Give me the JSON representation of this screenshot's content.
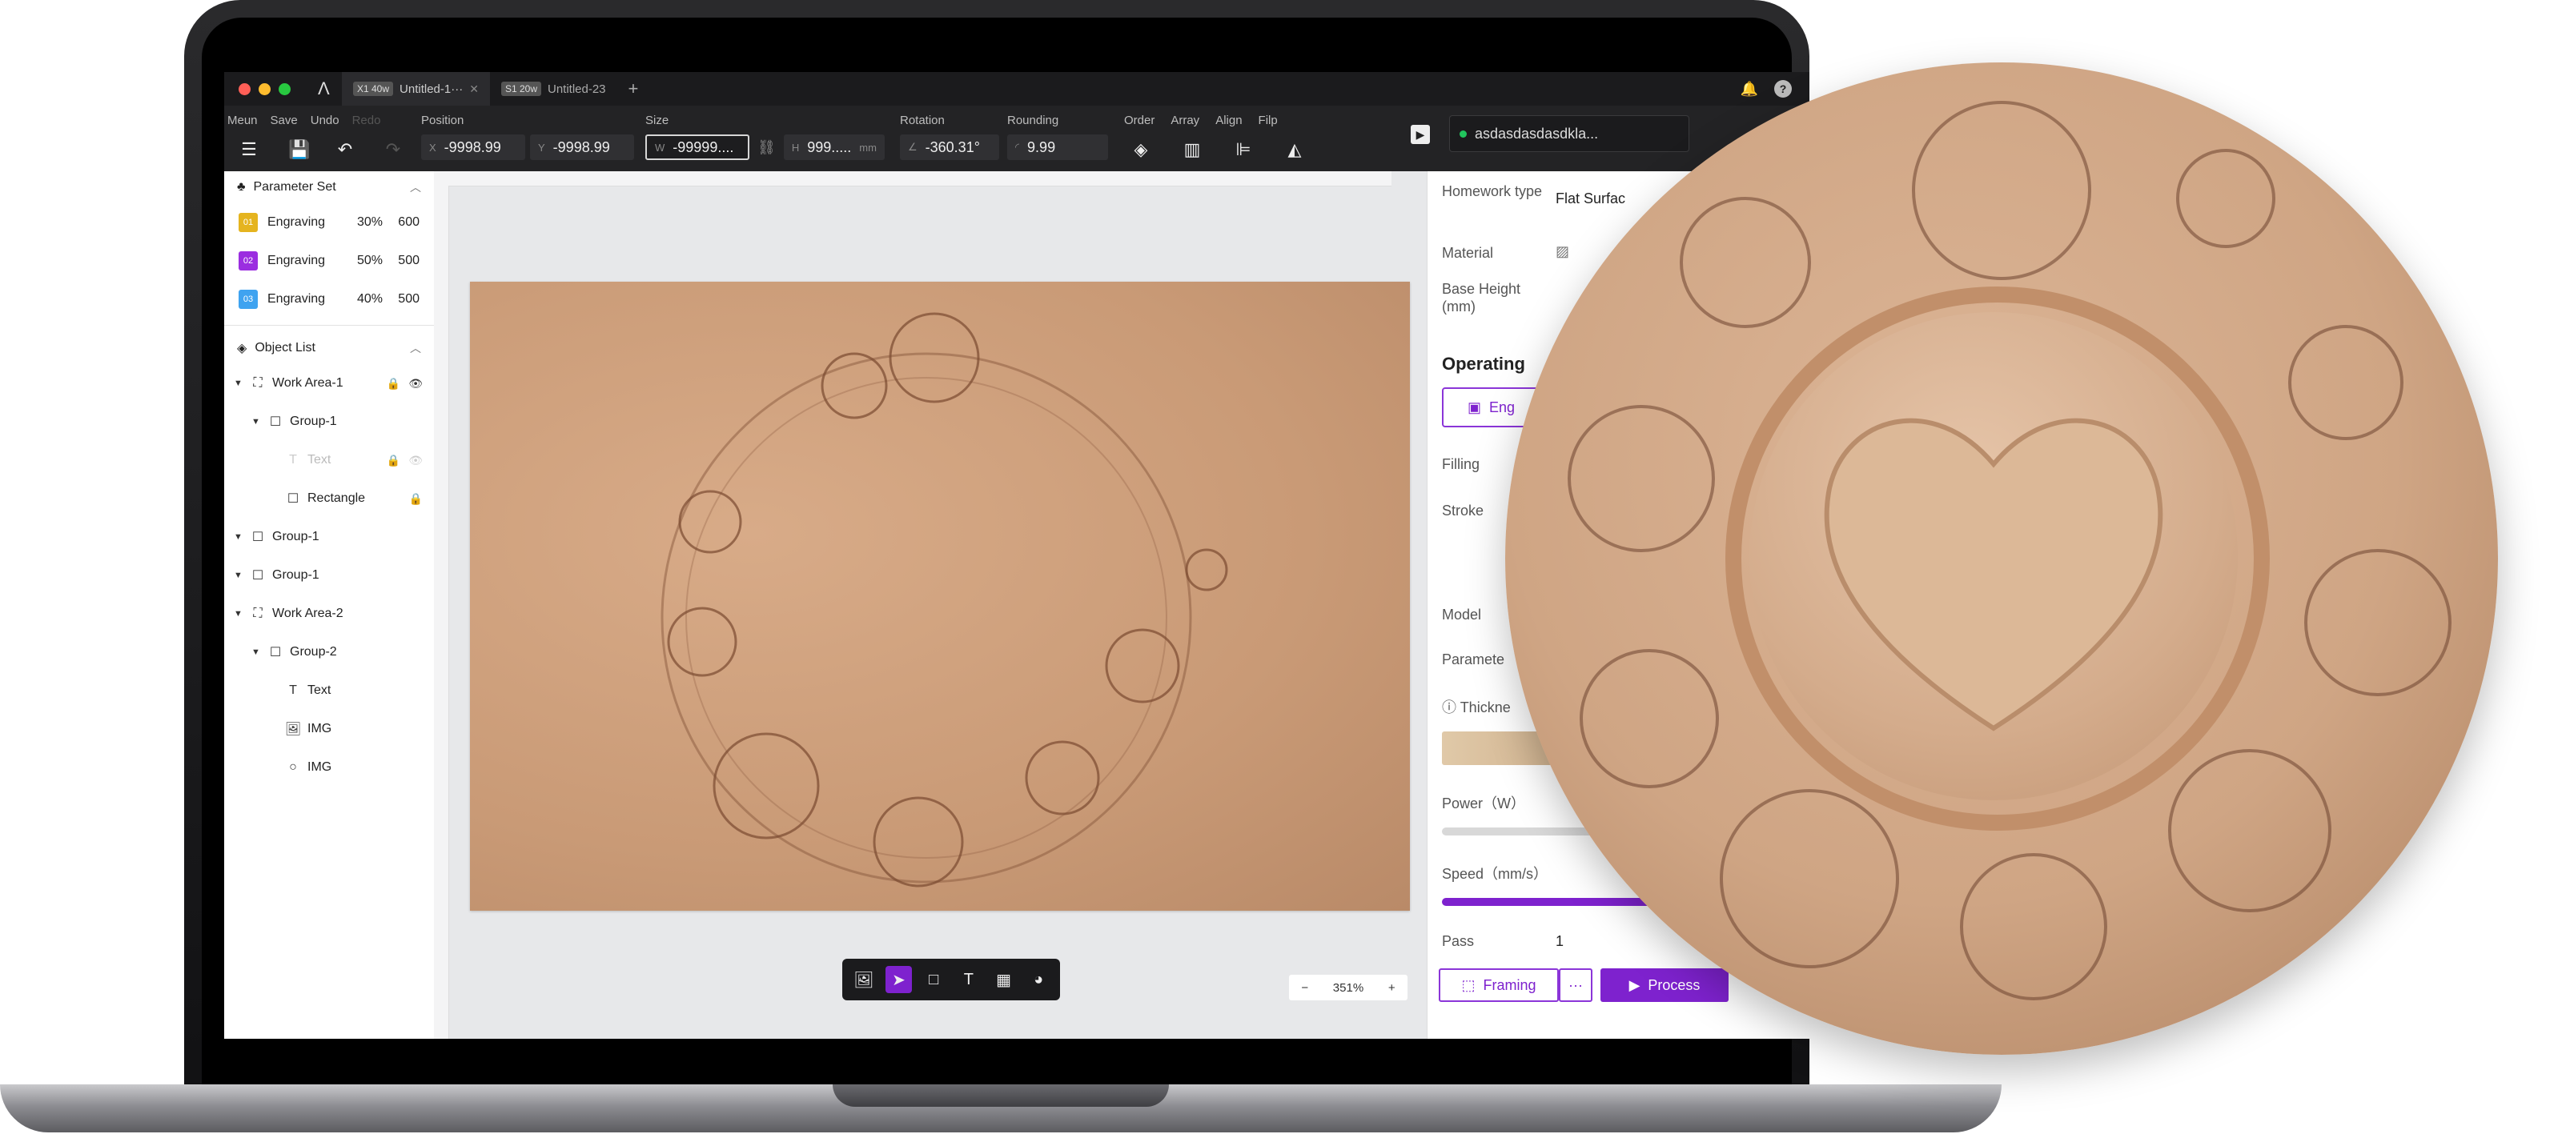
{
  "window": {
    "tabs": [
      {
        "badge": "X1 40w",
        "title": "Untitled-1···",
        "active": true
      },
      {
        "badge": "S1 20w",
        "title": "Untitled-23",
        "active": false
      }
    ],
    "add_tab": "+",
    "logo": "Λ"
  },
  "toolbar": {
    "menu_label": "Meun",
    "save_label": "Save",
    "undo_label": "Undo",
    "redo_label": "Redo",
    "position_label": "Position",
    "pos_x_prefix": "X",
    "pos_x": "-9998.99",
    "pos_y_prefix": "Y",
    "pos_y": "-9998.99",
    "size_label": "Size",
    "size_w_prefix": "W",
    "size_w": "-99999....",
    "size_h_prefix": "H",
    "size_h": "999.....",
    "size_unit": "mm",
    "rotation_label": "Rotation",
    "rotation": "-360.31°",
    "rounding_label": "Rounding",
    "rounding": "9.99",
    "order_label": "Order",
    "array_label": "Array",
    "align_label": "Align",
    "flip_label": "Filp",
    "device_name": "asdasdasdasdkla..."
  },
  "parameter_set": {
    "title": "Parameter Set",
    "items": [
      {
        "id": "01",
        "mode": "Engraving",
        "power": "30%",
        "speed": "600",
        "color": "#e5b41f"
      },
      {
        "id": "02",
        "mode": "Engraving",
        "power": "50%",
        "speed": "500",
        "color": "#9b2ee0"
      },
      {
        "id": "03",
        "mode": "Engraving",
        "power": "40%",
        "speed": "500",
        "color": "#3fa3f0"
      }
    ]
  },
  "object_list": {
    "title": "Object List",
    "items": [
      {
        "label": "Work Area-1",
        "icon": "work-area-icon",
        "indent": 0,
        "expand": true,
        "lock": true,
        "eye": true,
        "dim": false
      },
      {
        "label": "Group-1",
        "icon": "group-icon",
        "indent": 1,
        "expand": true,
        "lock": false,
        "eye": false,
        "dim": false
      },
      {
        "label": "Text",
        "icon": "text-icon",
        "indent": 2,
        "expand": false,
        "lock": true,
        "eye": true,
        "dim": true
      },
      {
        "label": "Rectangle",
        "icon": "rectangle-icon",
        "indent": 2,
        "expand": false,
        "lock": true,
        "eye": false,
        "dim": false
      },
      {
        "label": "Group-1",
        "icon": "group-icon",
        "indent": 0,
        "expand": true,
        "lock": false,
        "eye": false,
        "dim": false
      },
      {
        "label": "Group-1",
        "icon": "group-icon",
        "indent": 0,
        "expand": true,
        "lock": false,
        "eye": false,
        "dim": false
      },
      {
        "label": "Work Area-2",
        "icon": "work-area-icon",
        "indent": 0,
        "expand": true,
        "lock": false,
        "eye": false,
        "dim": false
      },
      {
        "label": "Group-2",
        "icon": "group-icon",
        "indent": 1,
        "expand": true,
        "lock": false,
        "eye": false,
        "dim": false
      },
      {
        "label": "Text",
        "icon": "text-icon",
        "indent": 2,
        "expand": false,
        "lock": false,
        "eye": false,
        "dim": false
      },
      {
        "label": "IMG",
        "icon": "image-icon",
        "indent": 2,
        "expand": false,
        "lock": false,
        "eye": false,
        "dim": false
      },
      {
        "label": "IMG",
        "icon": "circle-icon",
        "indent": 2,
        "expand": false,
        "lock": false,
        "eye": false,
        "dim": false
      }
    ]
  },
  "canvas": {
    "zoom": "351%",
    "zoom_minus": "−",
    "zoom_plus": "+"
  },
  "right_panel": {
    "homework_type_label": "Homework type",
    "homework_type_value": "Flat Surfac",
    "material_label": "Material",
    "base_height_label": "Base Height (mm)",
    "operating_title": "Operating",
    "engrave_tab": "Eng",
    "filling_label": "Filling",
    "stroke_label": "Stroke",
    "model_label": "Model",
    "parameter_label": "Paramete",
    "thickness_label": "Thickne",
    "power_label": "Power（W）",
    "speed_label": "Speed（mm/s）",
    "pass_label": "Pass",
    "pass_value": "1",
    "framing_label": "Framing",
    "more_label": "···",
    "process_label": "Process"
  },
  "colors": {
    "accent": "#7e22ce",
    "toolbar_bg": "#232325",
    "titlebar_bg": "#1b1b1d"
  }
}
